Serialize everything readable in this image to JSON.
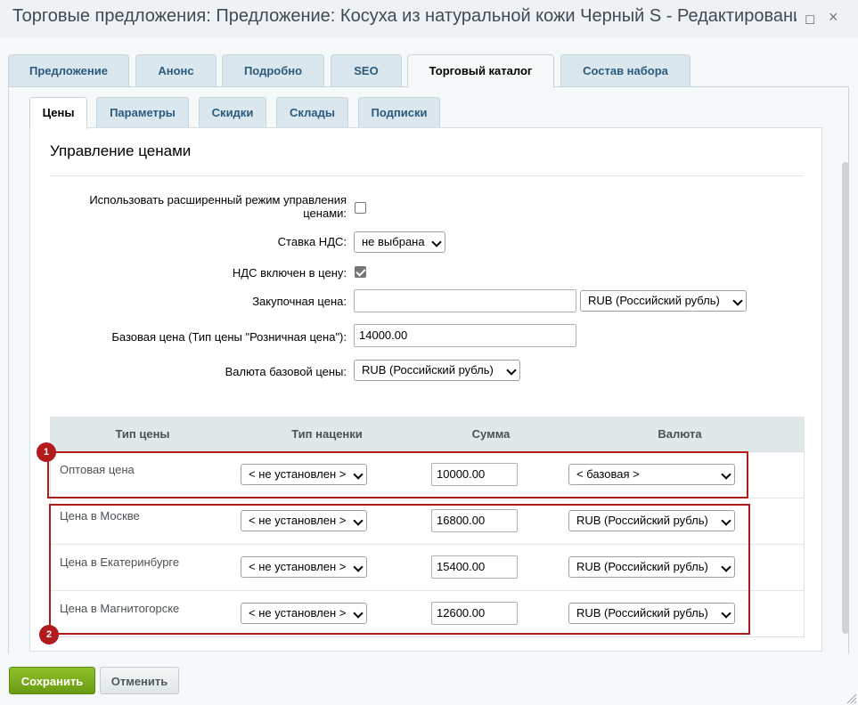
{
  "window": {
    "title": "Торговые предложения: Предложение: Косуха из натуральной кожи Черный S - Редактирование",
    "maximize_icon": "◻",
    "close_icon": "×"
  },
  "top_tabs": [
    {
      "label": "Предложение",
      "active": false
    },
    {
      "label": "Анонс",
      "active": false
    },
    {
      "label": "Подробно",
      "active": false
    },
    {
      "label": "SEO",
      "active": false
    },
    {
      "label": "Торговый каталог",
      "active": true
    },
    {
      "label": "Состав набора",
      "active": false
    }
  ],
  "sub_tabs": [
    {
      "label": "Цены",
      "active": true
    },
    {
      "label": "Параметры",
      "active": false
    },
    {
      "label": "Скидки",
      "active": false
    },
    {
      "label": "Склады",
      "active": false
    },
    {
      "label": "Подписки",
      "active": false
    }
  ],
  "section_title": "Управление ценами",
  "form": {
    "extended_mode_label_line1": "Использовать расширенный режим управления",
    "extended_mode_label_line2": "ценами:",
    "extended_mode_checked": false,
    "vat_rate_label": "Ставка НДС:",
    "vat_rate_value": "не выбрана",
    "vat_included_label": "НДС включен в цену:",
    "vat_included_checked": true,
    "purchase_price_label": "Закупочная цена:",
    "purchase_price_value": "",
    "purchase_currency": "RUB (Российский рубль)",
    "base_price_label": "Базовая цена (Тип цены \"Розничная цена\"):",
    "base_price_value": "14000.00",
    "base_currency_label": "Валюта базовой цены:",
    "base_currency_value": "RUB (Российский рубль)"
  },
  "price_table": {
    "headers": [
      "Тип цены",
      "Тип наценки",
      "Сумма",
      "Валюта"
    ],
    "rows": [
      {
        "name": "Оптовая цена",
        "markup": "< не установлен >",
        "amount": "10000.00",
        "currency": "< базовая >"
      },
      {
        "name": "Цена в Москве",
        "markup": "< не установлен >",
        "amount": "16800.00",
        "currency": "RUB (Российский рубль)"
      },
      {
        "name": "Цена в Екатеринбурге",
        "markup": "< не установлен >",
        "amount": "15400.00",
        "currency": "RUB (Российский рубль)"
      },
      {
        "name": "Цена в Магнитогорске",
        "markup": "< не установлен >",
        "amount": "12600.00",
        "currency": "RUB (Российский рубль)"
      }
    ]
  },
  "callouts": [
    "1",
    "2"
  ],
  "buttons": {
    "save": "Сохранить",
    "cancel": "Отменить"
  },
  "colors": {
    "callout": "#b21b1b",
    "save_button": "#7aac1c",
    "tab_text": "#2c5a7d"
  }
}
